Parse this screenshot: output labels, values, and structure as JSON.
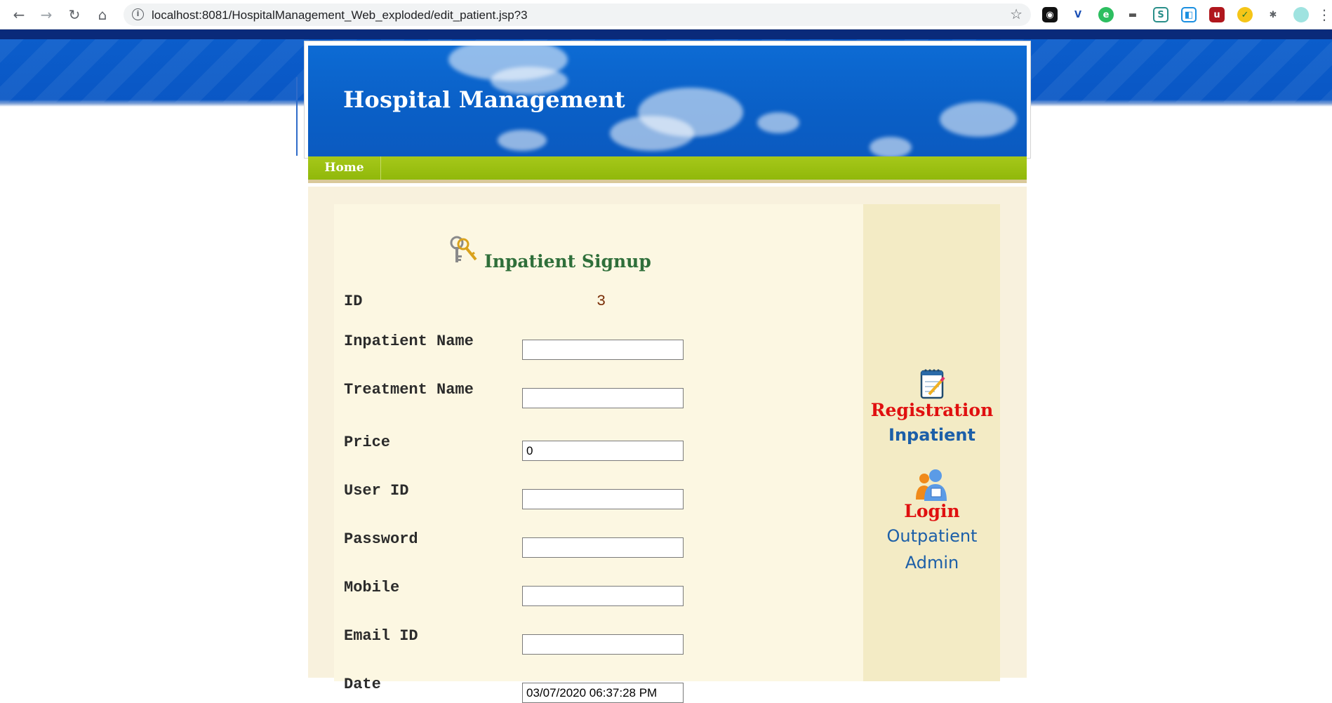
{
  "browser": {
    "url": "localhost:8081/HospitalManagement_Web_exploded/edit_patient.jsp?3"
  },
  "header": {
    "title": "Hospital Management",
    "colors": {
      "banner": "#0b5fc6",
      "nav": "#9cc212",
      "title": "#ffffff"
    }
  },
  "nav": {
    "home_label": "Home"
  },
  "form": {
    "title": "Inpatient Signup",
    "id_label": "ID",
    "id_value": "3",
    "fields": {
      "inpatient_name": {
        "label": "Inpatient Name",
        "value": ""
      },
      "treatment_name": {
        "label": "Treatment Name",
        "value": ""
      },
      "price": {
        "label": "Price",
        "value": "0"
      },
      "user_id": {
        "label": "User ID",
        "value": ""
      },
      "password": {
        "label": "Password",
        "value": ""
      },
      "mobile": {
        "label": "Mobile",
        "value": ""
      },
      "email_id": {
        "label": "Email ID",
        "value": ""
      },
      "date": {
        "label": "Date",
        "value": "03/07/2020 06:37:28 PM"
      }
    }
  },
  "sidebar": {
    "registration_label": "Registration",
    "inpatient_label": "Inpatient",
    "login_label": "Login",
    "outpatient_label": "Outpatient",
    "admin_label": "Admin",
    "icons": [
      "notepad-icon",
      "users-icon"
    ]
  }
}
